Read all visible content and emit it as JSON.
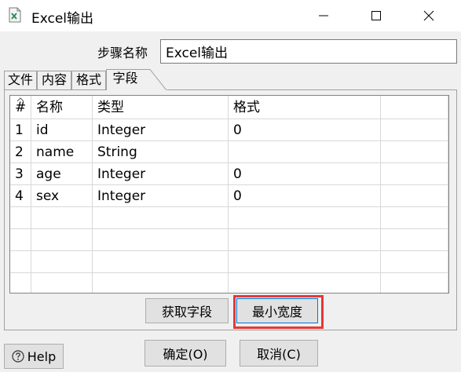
{
  "window": {
    "title": "Excel输出"
  },
  "step": {
    "label": "步骤名称",
    "value": "Excel输出"
  },
  "tabs": [
    {
      "label": "文件",
      "active": false
    },
    {
      "label": "内容",
      "active": false
    },
    {
      "label": "格式",
      "active": false
    },
    {
      "label": "字段",
      "active": true
    }
  ],
  "table": {
    "headers": [
      "#",
      "名称",
      "类型",
      "格式"
    ],
    "rows": [
      [
        "1",
        "id",
        "Integer",
        "0"
      ],
      [
        "2",
        "name",
        "String",
        ""
      ],
      [
        "3",
        "age",
        "Integer",
        "0"
      ],
      [
        "4",
        "sex",
        "Integer",
        "0"
      ]
    ]
  },
  "buttons": {
    "fetch_fields": "获取字段",
    "min_width": "最小宽度",
    "help": "Help",
    "ok": "确定(O)",
    "cancel": "取消(C)"
  },
  "colors": {
    "highlight": "#e53935",
    "focus_border": "#0078d7",
    "app_icon": "#2e8b57"
  },
  "icons": {
    "app": "excel-file-icon",
    "help": "question-circle-icon"
  }
}
